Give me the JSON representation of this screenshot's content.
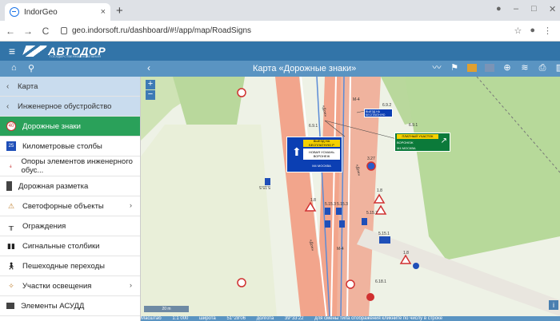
{
  "browser": {
    "tab_title": "IndorGeo",
    "tab_close": "×",
    "new_tab": "+",
    "url": "geo.indorsoft.ru/dashboard/#!/app/map/RoadSigns"
  },
  "app": {
    "logo_text": "АВТОДОР",
    "logo_subtitle": "ГОСУДАРСТВЕННАЯ КОМПАНИЯ"
  },
  "toolbar": {
    "map_title": "Карта «Дорожные знаки»"
  },
  "sidebar": {
    "items": [
      {
        "label": "Карта",
        "icon": "chevron-left-icon"
      },
      {
        "label": "Инженерное обустройство",
        "icon": "chevron-left-icon"
      },
      {
        "label": "Дорожные знаки",
        "icon": "road-sign-icon"
      },
      {
        "label": "Километровые столбы",
        "icon": "km-post-icon"
      },
      {
        "label": "Опоры элементов инженерного обус...",
        "icon": "support-icon"
      },
      {
        "label": "Дорожная разметка",
        "icon": "road-marking-icon"
      },
      {
        "label": "Светофорные объекты",
        "icon": "traffic-light-icon"
      },
      {
        "label": "Ограждения",
        "icon": "fence-icon"
      },
      {
        "label": "Сигнальные столбики",
        "icon": "signal-post-icon"
      },
      {
        "label": "Пешеходные переходы",
        "icon": "pedestrian-icon"
      },
      {
        "label": "Участки освещения",
        "icon": "lighting-icon"
      },
      {
        "label": "Элементы АСУДД",
        "icon": "asudd-icon"
      }
    ]
  },
  "map": {
    "zoom_in": "+",
    "zoom_out": "−",
    "scale_bar": "20 m",
    "info": "i",
    "big_sign": {
      "top": "ВЫЕЗД НА БЕСПЛАТНУЮ Р",
      "middle": "НОВАЯ УСМАНЬ ВОРОНЕЖ",
      "bottom": "М4 МОСКВА"
    },
    "green_sign": {
      "top": "ПЛАТНЫЙ УЧАСТОК",
      "line1": "ВОРОНЕЖ",
      "line2": "М4 МОСКВА"
    },
    "small_blue_sign": "ВЫЕЗД НА БЕСПЛАТНУЮ",
    "labels": [
      "6.9.2",
      "6.9.1",
      "6.9.1",
      "3.27",
      "5.15.3",
      "5.15.3",
      "5.15.7",
      "5.15.1",
      "1.8",
      "1.8",
      "1.8",
      "6.18.1",
      "М-4",
      "М-4",
      "«Дон»",
      "«Дон»",
      "«Дон»",
      "5.15.5"
    ]
  },
  "statusbar": {
    "scale_label": "Масштаб",
    "scale_value": "1:1 000",
    "lat_label": "широта",
    "lat_value": "51°28'06",
    "lon_label": "долгота",
    "lon_value": "39°33'22",
    "hint": "для смены типа отображения кликните по числу в строке"
  }
}
